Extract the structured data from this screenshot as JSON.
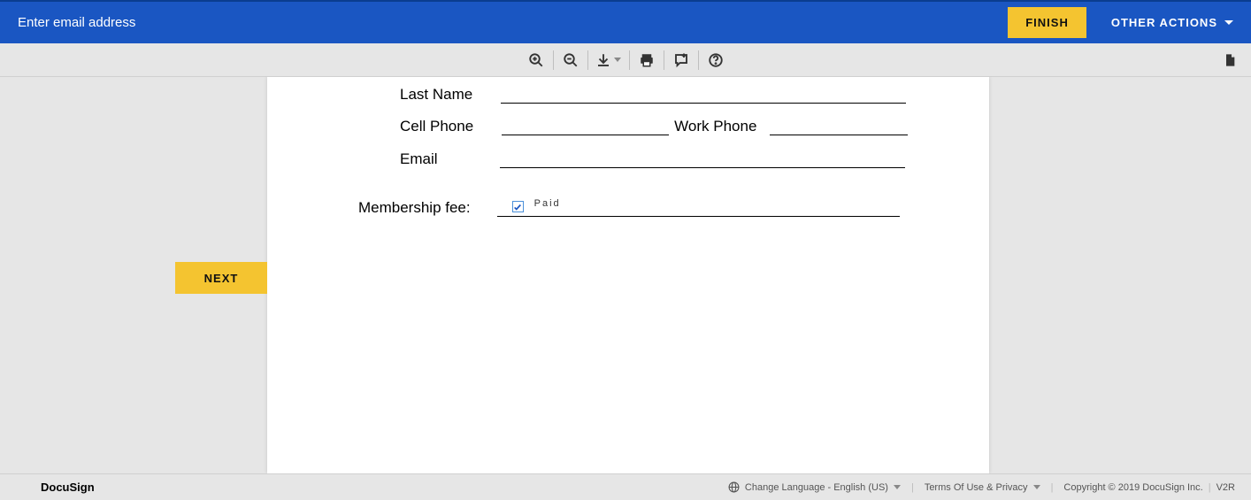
{
  "topbar": {
    "title": "Enter email address",
    "finish_label": "FINISH",
    "other_actions_label": "OTHER ACTIONS"
  },
  "toolbar": {
    "zoom_in": "zoom-in",
    "zoom_out": "zoom-out",
    "download": "download",
    "print": "print",
    "comment": "comment",
    "help": "help",
    "thumbnails": "thumbnails"
  },
  "form": {
    "last_name_label": "Last Name",
    "last_name_value": "",
    "cell_phone_label": "Cell Phone",
    "cell_phone_value": "",
    "work_phone_label": "Work Phone",
    "work_phone_value": "",
    "email_label": "Email",
    "email_value": "",
    "membership_fee_label": "Membership fee:",
    "paid_checked": true,
    "paid_label": "Paid"
  },
  "nav": {
    "next_label": "NEXT"
  },
  "footer": {
    "brand": "DocuSign",
    "change_language_label": "Change Language - English (US)",
    "terms_label": "Terms Of Use & Privacy",
    "copyright": "Copyright © 2019 DocuSign Inc.",
    "version": "V2R"
  }
}
